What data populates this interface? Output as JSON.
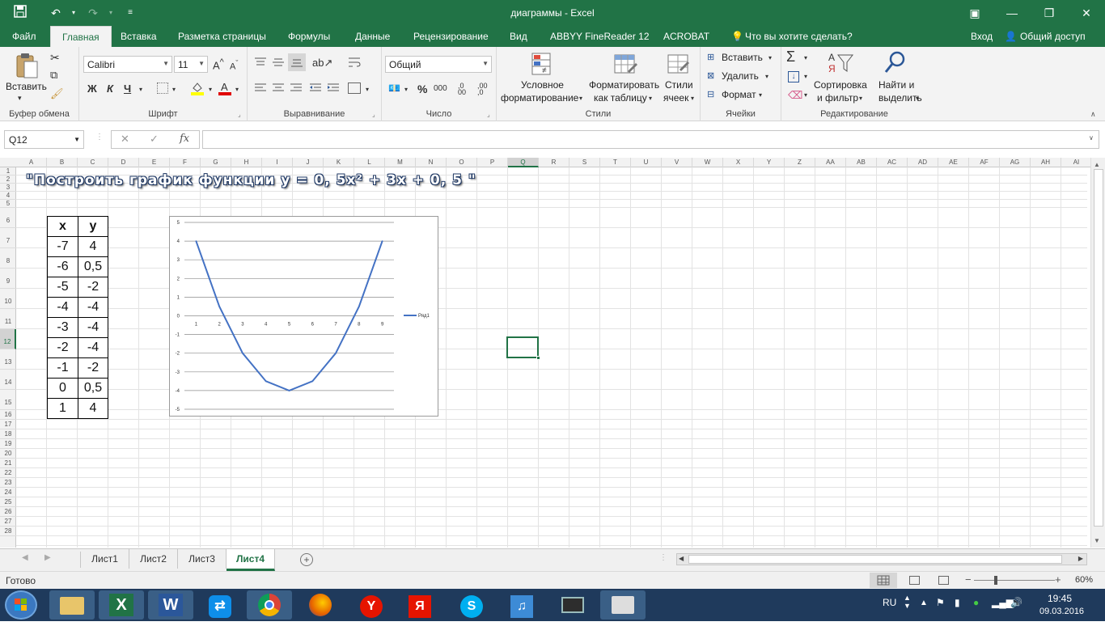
{
  "window": {
    "title": "диаграммы - Excel",
    "save_icon": "save-icon",
    "undo_icon": "undo-icon",
    "redo_icon": "redo-icon"
  },
  "menu": {
    "items": [
      "Файл",
      "Главная",
      "Вставка",
      "Разметка страницы",
      "Формулы",
      "Данные",
      "Рецензирование",
      "Вид",
      "ABBYY FineReader 12",
      "ACROBAT"
    ],
    "search": "Что вы хотите сделать?",
    "signin": "Вход",
    "share": "Общий доступ"
  },
  "ribbon": {
    "clipboard": {
      "paste": "Вставить",
      "label": "Буфер обмена"
    },
    "font": {
      "name": "Calibri",
      "size": "11",
      "bold": "Ж",
      "italic": "К",
      "underline": "Ч",
      "label": "Шрифт"
    },
    "alignment": {
      "label": "Выравнивание"
    },
    "number": {
      "format": "Общий",
      "percent": "%",
      "thousands": "000",
      "label": "Число"
    },
    "styles": {
      "conditional_1": "Условное",
      "conditional_2": "форматирование",
      "table_1": "Форматировать",
      "table_2": "как таблицу",
      "cells_1": "Стили",
      "cells_2": "ячеек",
      "label": "Стили"
    },
    "cells": {
      "insert": "Вставить",
      "delete": "Удалить",
      "format": "Формат",
      "label": "Ячейки"
    },
    "editing": {
      "sort_1": "Сортировка",
      "sort_2": "и фильтр",
      "find_1": "Найти и",
      "find_2": "выделить",
      "label": "Редактирование"
    }
  },
  "formula_bar": {
    "name_box": "Q12",
    "fx": "fx",
    "value": ""
  },
  "sheet": {
    "columns": [
      "A",
      "B",
      "C",
      "D",
      "E",
      "F",
      "G",
      "H",
      "I",
      "J",
      "K",
      "L",
      "M",
      "N",
      "O",
      "P",
      "Q",
      "R",
      "S",
      "T",
      "U",
      "V",
      "W",
      "X",
      "Y",
      "Z",
      "AA",
      "AB",
      "AC",
      "AD",
      "AE",
      "AF",
      "AG",
      "AH",
      "AI"
    ],
    "rows": [
      "1",
      "2",
      "3",
      "4",
      "5",
      "6",
      "7",
      "8",
      "9",
      "10",
      "11",
      "12",
      "13",
      "14",
      "15",
      "16",
      "17",
      "18",
      "19",
      "20",
      "21",
      "22",
      "23",
      "24",
      "25",
      "26",
      "27",
      "28"
    ],
    "heading": "\"Построить график функции  y = 0, 5x² + 3x + 0, 5 \"",
    "table_headers": [
      "x",
      "y"
    ],
    "table_rows": [
      [
        "-7",
        "4"
      ],
      [
        "-6",
        "0,5"
      ],
      [
        "-5",
        "-2"
      ],
      [
        "-4",
        "-4"
      ],
      [
        "-3",
        "-4"
      ],
      [
        "-2",
        "-4"
      ],
      [
        "-1",
        "-2"
      ],
      [
        "0",
        "0,5"
      ],
      [
        "1",
        "4"
      ]
    ]
  },
  "chart_data": {
    "type": "line",
    "categories": [
      "1",
      "2",
      "3",
      "4",
      "5",
      "6",
      "7",
      "8",
      "9"
    ],
    "series": [
      {
        "name": "Ряд1",
        "values": [
          4,
          0.5,
          -2,
          -3.5,
          -4,
          -3.5,
          -2,
          0.5,
          4
        ]
      }
    ],
    "yticks": [
      "5",
      "4",
      "3",
      "2",
      "1",
      "0",
      "-1",
      "-2",
      "-3",
      "-4",
      "-5"
    ],
    "ylim": [
      -5,
      5
    ],
    "grid": true,
    "legend": "right",
    "line_color": "#4472c4"
  },
  "tabs": {
    "items": [
      "Лист1",
      "Лист2",
      "Лист3",
      "Лист4"
    ],
    "active": "Лист4"
  },
  "status": {
    "ready": "Готово",
    "zoom": "60%"
  },
  "taskbar": {
    "lang": "RU",
    "time": "19:45",
    "date": "09.03.2016"
  },
  "colors": {
    "accent": "#217346",
    "taskbar": "#1f3a5c"
  }
}
